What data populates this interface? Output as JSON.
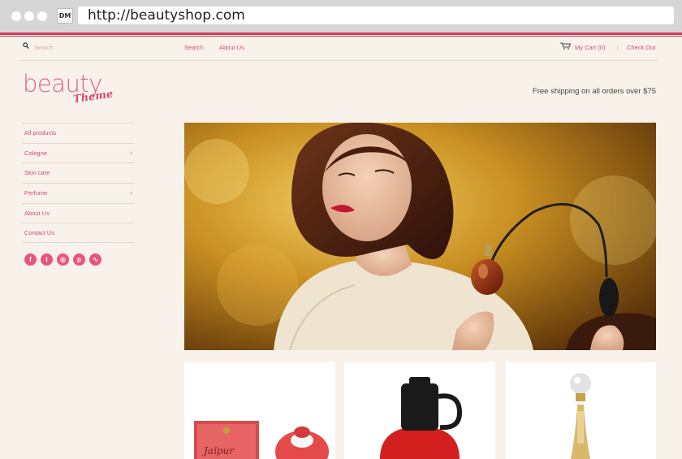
{
  "browser": {
    "favicon_text": "DM",
    "url": "http://beautyshop.com"
  },
  "topbar": {
    "search_placeholder": "Search",
    "nav": [
      "Search",
      "About Us"
    ],
    "cart_label": "My Cart (0)",
    "separator": "|",
    "checkout_label": "Check Out"
  },
  "logo": {
    "main": "beauty",
    "sub": "Theme"
  },
  "shipping_text": "Free shipping on all orders over $75",
  "sidebar": {
    "items": [
      {
        "label": "All products",
        "expandable": false
      },
      {
        "label": "Cologne",
        "expandable": true
      },
      {
        "label": "Skin care",
        "expandable": false
      },
      {
        "label": "Perfume",
        "expandable": true
      },
      {
        "label": "About Us",
        "expandable": false
      },
      {
        "label": "Contact Us",
        "expandable": false
      }
    ],
    "expand_symbol": "+"
  },
  "social": [
    {
      "name": "facebook-icon",
      "glyph": "f"
    },
    {
      "name": "twitter-icon",
      "glyph": "t"
    },
    {
      "name": "instagram-icon",
      "glyph": "◎"
    },
    {
      "name": "pinterest-icon",
      "glyph": "p"
    },
    {
      "name": "rss-icon",
      "glyph": "∿"
    }
  ],
  "hero": {
    "alt": "Woman with curly auburn hair holding a perfume atomizer"
  },
  "product_label": "Jaïpur",
  "colors": {
    "accent": "#d84c6b",
    "page_bg": "#f8f2ea",
    "social": "#e8557b"
  }
}
